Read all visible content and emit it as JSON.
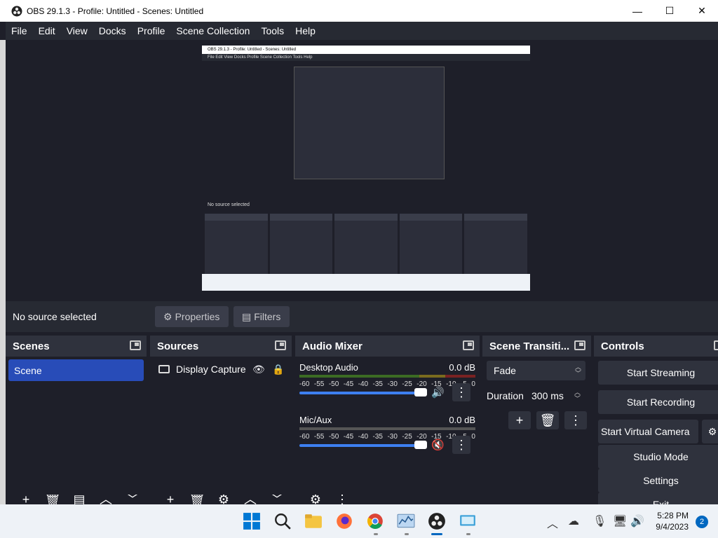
{
  "window": {
    "title": "OBS 29.1.3 - Profile: Untitled - Scenes: Untitled",
    "minimize": "—",
    "maximize": "☐",
    "close": "✕"
  },
  "menu": [
    "File",
    "Edit",
    "View",
    "Docks",
    "Profile",
    "Scene Collection",
    "Tools",
    "Help"
  ],
  "preview": {
    "nested_title": "OBS 29.1.3 - Profile: Untitled - Scenes: Untitled",
    "nested_menu": "File  Edit  View  Docks  Profile  Scene Collection  Tools  Help",
    "nested_status": "No source selected"
  },
  "status": {
    "no_source": "No source selected",
    "properties": "Properties",
    "filters": "Filters"
  },
  "docks": {
    "scenes": {
      "title": "Scenes",
      "items": [
        "Scene"
      ]
    },
    "sources": {
      "title": "Sources",
      "items": [
        "Display Capture"
      ]
    },
    "mixer": {
      "title": "Audio Mixer",
      "scale": [
        "-60",
        "-55",
        "-50",
        "-45",
        "-40",
        "-35",
        "-30",
        "-25",
        "-20",
        "-15",
        "-10",
        "-5",
        "0"
      ],
      "channels": [
        {
          "name": "Desktop Audio",
          "db": "0.0 dB",
          "muted": false,
          "volume_fraction": 1.0
        },
        {
          "name": "Mic/Aux",
          "db": "0.0 dB",
          "muted": true,
          "volume_fraction": 1.0
        }
      ]
    },
    "transitions": {
      "title": "Scene Transiti...",
      "selected": "Fade",
      "duration_label": "Duration",
      "duration_value": "300 ms"
    },
    "controls": {
      "title": "Controls",
      "start_streaming": "Start Streaming",
      "start_recording": "Start Recording",
      "start_virtual_camera": "Start Virtual Camera",
      "studio_mode": "Studio Mode",
      "settings": "Settings",
      "exit": "Exit"
    }
  },
  "taskbar": {
    "clock_time": "5:28 PM",
    "clock_date": "9/4/2023",
    "notification_count": "2"
  },
  "colors": {
    "accent": "#284cb8",
    "fader": "#3d7ff0",
    "mute_red": "#c8252c",
    "background": "#1e1f29",
    "dock": "#272a33"
  }
}
